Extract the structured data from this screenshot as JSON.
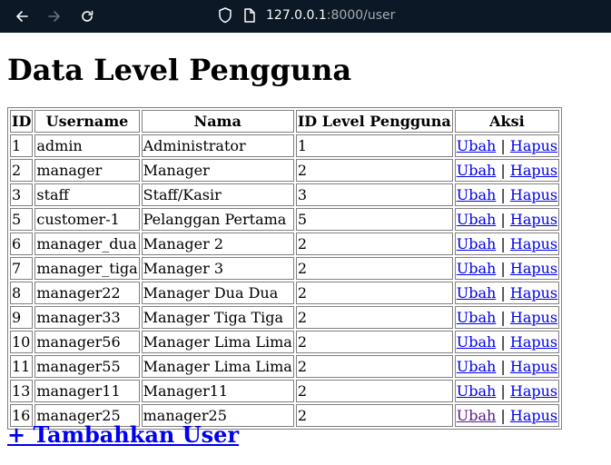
{
  "browser": {
    "url_host": "127.0.0.1",
    "url_rest": ":8000/user"
  },
  "page": {
    "title": "Data Level Pengguna",
    "add_link": "+ Tambahkan User"
  },
  "table": {
    "headers": [
      "ID",
      "Username",
      "Nama",
      "ID Level Pengguna",
      "Aksi"
    ],
    "edit_label": "Ubah",
    "separator": "|",
    "delete_label": "Hapus",
    "rows": [
      {
        "id": "1",
        "username": "admin",
        "nama": "Administrator",
        "level": "1"
      },
      {
        "id": "2",
        "username": "manager",
        "nama": "Manager",
        "level": "2"
      },
      {
        "id": "3",
        "username": "staff",
        "nama": "Staff/Kasir",
        "level": "3"
      },
      {
        "id": "5",
        "username": "customer-1",
        "nama": "Pelanggan Pertama",
        "level": "5"
      },
      {
        "id": "6",
        "username": "manager_dua",
        "nama": "Manager 2",
        "level": "2"
      },
      {
        "id": "7",
        "username": "manager_tiga",
        "nama": "Manager 3",
        "level": "2"
      },
      {
        "id": "8",
        "username": "manager22",
        "nama": "Manager Dua Dua",
        "level": "2"
      },
      {
        "id": "9",
        "username": "manager33",
        "nama": "Manager Tiga Tiga",
        "level": "2"
      },
      {
        "id": "10",
        "username": "manager56",
        "nama": "Manager Lima Lima",
        "level": "2"
      },
      {
        "id": "11",
        "username": "manager55",
        "nama": "Manager Lima Lima",
        "level": "2"
      },
      {
        "id": "13",
        "username": "manager11",
        "nama": "Manager11",
        "level": "2"
      },
      {
        "id": "16",
        "username": "manager25",
        "nama": "manager25",
        "level": "2",
        "edit_visited": true
      }
    ]
  }
}
